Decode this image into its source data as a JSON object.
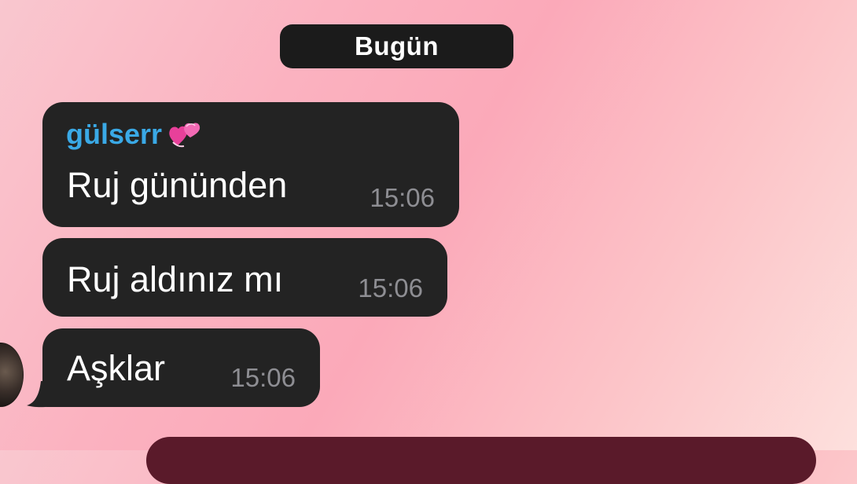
{
  "chat": {
    "date_separator": "Bugün",
    "messages": [
      {
        "sender": "gülserr",
        "sender_icon": "two-hearts-icon",
        "text": "Ruj gününden",
        "time": "15:06"
      },
      {
        "text": "Ruj aldınız mı",
        "time": "15:06"
      },
      {
        "text": "Aşklar",
        "time": "15:06"
      }
    ]
  },
  "colors": {
    "bubble_bg": "#232323",
    "sender_name": "#3aa9e6",
    "timestamp": "#8e8e93",
    "outgoing_bubble": "#5a1a2a"
  }
}
